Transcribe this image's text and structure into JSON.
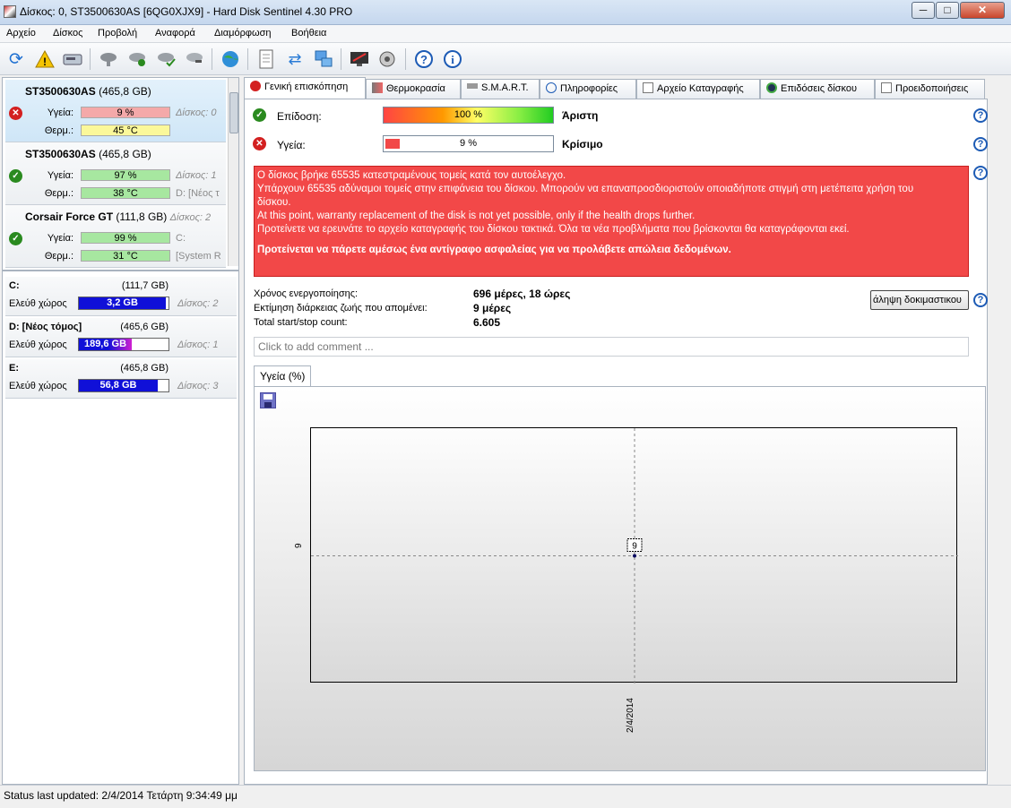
{
  "window": {
    "title": "Δίσκος: 0, ST3500630AS [6QG0XJX9]  -  Hard Disk Sentinel 4.30 PRO",
    "min_glyph": "─",
    "max_glyph": "□",
    "close_glyph": "✕"
  },
  "menu": [
    "Αρχείο",
    "Δίσκος",
    "Προβολή",
    "Αναφορά",
    "Διαμόρφωση",
    "Βοήθεια"
  ],
  "toolbar": {
    "icons": [
      "refresh-icon",
      "warning-icon",
      "disk-icon",
      "disk-gray-icon",
      "disk-ok-icon",
      "disk-check-icon",
      "disk-tool-icon",
      "globe-icon",
      "report-icon",
      "sync-icon",
      "network-icon",
      "monitor-icon",
      "speaker-icon",
      "help-icon",
      "info-icon"
    ]
  },
  "disks": [
    {
      "name": "ST3500630AS",
      "size": "(465,8 GB)",
      "status": "bad",
      "health_label": "Υγεία:",
      "health": "9 %",
      "health_pct": 9,
      "health_color": "#f4a9a9",
      "temp_label": "Θερμ.:",
      "temp": "45 °C",
      "temp_color": "#fbf89a",
      "extra1": "Δίσκος: 0",
      "extra2": ""
    },
    {
      "name": "ST3500630AS",
      "size": "(465,8 GB)",
      "status": "ok",
      "health_label": "Υγεία:",
      "health": "97 %",
      "health_pct": 97,
      "health_color": "#a7e7a0",
      "temp_label": "Θερμ.:",
      "temp": "38 °C",
      "temp_color": "#a7e7a0",
      "extra1": "Δίσκος: 1",
      "extra2": "D: [Νέος τ"
    },
    {
      "name": "Corsair Force GT",
      "size": "(111,8 GB)",
      "status": "ok",
      "health_label": "Υγεία:",
      "health": "99 %",
      "health_pct": 99,
      "health_color": "#a7e7a0",
      "temp_label": "Θερμ.:",
      "temp": "31 °C",
      "temp_color": "#a7e7a0",
      "extra1": "C:",
      "extra2": "[System R",
      "disk_no": "Δίσκος: 2"
    }
  ],
  "volumes": [
    {
      "name": "C:",
      "cap": "(111,7 GB)",
      "free_label": "Ελεύθ χώρος",
      "free": "3,2 GB",
      "used_pct": 97,
      "disk": "Δίσκος: 2"
    },
    {
      "name": "D: [Νέος τόμος]",
      "cap": "(465,6 GB)",
      "free_label": "Ελεύθ χώρος",
      "free": "189,6 GB",
      "used_pct": 59,
      "disk": "Δίσκος: 1"
    },
    {
      "name": "E:",
      "cap": "(465,8 GB)",
      "free_label": "Ελεύθ χώρος",
      "free": "56,8 GB",
      "used_pct": 88,
      "disk": "Δίσκος: 3"
    }
  ],
  "tabs": [
    "Γενική επισκόπηση",
    "Θερμοκρασία",
    "S.M.A.R.T.",
    "Πληροφορίες",
    "Αρχείο Καταγραφής",
    "Επιδόσεις δίσκου",
    "Προειδοποιήσεις"
  ],
  "overview": {
    "performance_label": "Επίδοση:",
    "performance_value": "100 %",
    "performance_pct": 100,
    "performance_word": "Άριστη",
    "health_label": "Υγεία:",
    "health_value": "9 %",
    "health_pct": 9,
    "health_word": "Κρίσιμο",
    "help_glyph": "?",
    "alert_lines": [
      "Ο δίσκος βρήκε 65535 κατεστραμένους τομείς κατά τον αυτοέλεγχο.",
      "Υπάρχουν 65535 αδύναμοι τομείς στην επιφάνεια του δίσκου. Μπορούν να επαναπροσδιοριστούν οποιαδήποτε στιγμή στη μετέπειτα χρήση του",
      "δίσκου.",
      "At this point, warranty replacement of the disk is not yet possible, only if the health drops further.",
      "Προτείνετε να ερευνάτε το αρχείο καταγραφής του δίσκου τακτικά. Όλα τα νέα προβλήματα που βρίσκονται θα καταγράφονται εκεί."
    ],
    "alert_strong": "Προτείνεται να πάρετε αμέσως ένα αντίγραφο ασφαλείας για να προλάβετε απώλεια δεδομένων.",
    "power_on_label": "Χρόνος ενεργοποίησης:",
    "power_on_value": "696 μέρες, 18 ώρες",
    "lifetime_label": "Εκτίμηση διάρκειας ζωής που απομένει:",
    "lifetime_value": "9 μέρες",
    "startstop_label": "Total start/stop count:",
    "startstop_value": "6.605",
    "test_button": "άληψη δοκιμαστικου",
    "comment_placeholder": "Click to add comment ..."
  },
  "chart_tab": "Υγεία (%)",
  "chart_data": {
    "type": "line",
    "x": [
      "2/4/2014"
    ],
    "values": [
      9
    ],
    "y_tick_labels": [
      "9"
    ],
    "point_labels": [
      "9"
    ],
    "grid": true,
    "title": "",
    "xlabel": "",
    "ylabel": ""
  },
  "status": {
    "text": "Status last updated: 2/4/2014 Τετάρτη 9:34:49 μμ"
  }
}
